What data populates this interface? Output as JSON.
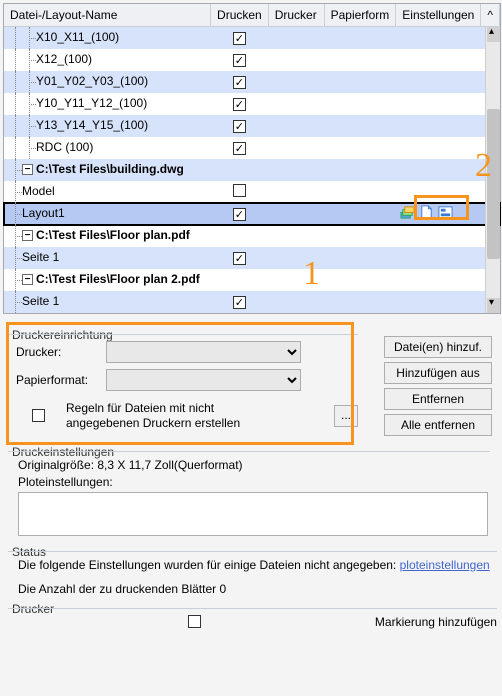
{
  "headers": {
    "name": "Datei-/Layout-Name",
    "print": "Drucken",
    "printer": "Drucker",
    "paper": "Papierform",
    "settings": "Einstellungen",
    "scroll_up": "^"
  },
  "rows": [
    {
      "indent": 2,
      "name": "X10_X11_(100)",
      "checked": true,
      "light": true
    },
    {
      "indent": 2,
      "name": "X12_(100)",
      "checked": true,
      "light": false
    },
    {
      "indent": 2,
      "name": "Y01_Y02_Y03_(100)",
      "checked": true,
      "light": true
    },
    {
      "indent": 2,
      "name": "Y10_Y11_Y12_(100)",
      "checked": true,
      "light": false
    },
    {
      "indent": 2,
      "name": "Y13_Y14_Y15_(100)",
      "checked": true,
      "light": true
    },
    {
      "indent": 2,
      "name": "RDC (100)",
      "checked": true,
      "light": false
    },
    {
      "indent": 0,
      "name": "C:\\Test Files\\building.dwg",
      "group": true,
      "light": true,
      "checked": null
    },
    {
      "indent": 1,
      "name": "Model",
      "checked": false,
      "light": false
    },
    {
      "indent": 1,
      "name": "Layout1",
      "checked": true,
      "light": true,
      "selected": true,
      "icons": true
    },
    {
      "indent": 0,
      "name": "C:\\Test Files\\Floor plan.pdf",
      "group": true,
      "light": false,
      "checked": null
    },
    {
      "indent": 1,
      "name": "Seite 1",
      "checked": true,
      "light": true
    },
    {
      "indent": 0,
      "name": "C:\\Test Files\\Floor plan 2.pdf",
      "group": true,
      "light": false,
      "checked": null
    },
    {
      "indent": 1,
      "name": "Seite 1",
      "checked": true,
      "light": true
    }
  ],
  "annotations": {
    "one": "1",
    "two": "2"
  },
  "setup": {
    "title": "Druckereinrichtung",
    "printer_label": "Drucker:",
    "paper_label": "Papierformat:",
    "rules_label": "Regeln für Dateien mit nicht angegebenen Druckern erstellen",
    "dots": "..."
  },
  "buttons": {
    "add_files": "Datei(en) hinzuf.",
    "add_from": "Hinzufügen aus",
    "remove": "Entfernen",
    "remove_all": "Alle entfernen"
  },
  "print_settings": {
    "title": "Druckeinstellungen",
    "original": "Originalgröße: 8,3 X 11,7 Zoll(Querformat)",
    "plot_label": "Ploteinstellungen:"
  },
  "status": {
    "title": "Status",
    "line1_pre": "Die folgende Einstellungen wurden für einige Dateien nicht angegeben:",
    "line1_link": "ploteinstellungen",
    "line2": "Die Anzahl der zu druckenden Blätter 0"
  },
  "printer_grp": {
    "title": "Drucker",
    "mark": "Markierung hinzufügen"
  }
}
